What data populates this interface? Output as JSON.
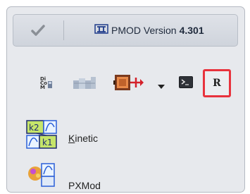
{
  "version_bar": {
    "app_name": "PMOD Version",
    "version_number": "4.301",
    "check_icon": "checkmark-icon",
    "logo_icon": "pmod-logo-icon"
  },
  "toolbar": {
    "items": [
      {
        "icon": "dicom-icon"
      },
      {
        "icon": "database-icon"
      },
      {
        "icon": "plugin-icon"
      },
      {
        "icon": "dropdown-arrow-icon"
      },
      {
        "icon": "console-icon"
      },
      {
        "icon": "r-icon",
        "label": "R",
        "highlighted": true
      }
    ],
    "highlight_color": "#e8333d"
  },
  "tools": [
    {
      "label": "Kinetic",
      "mnemonic": "K",
      "rest": "inetic",
      "icon": "kinetic-icon"
    },
    {
      "label": "PXMod",
      "icon": "pxmod-icon"
    }
  ]
}
